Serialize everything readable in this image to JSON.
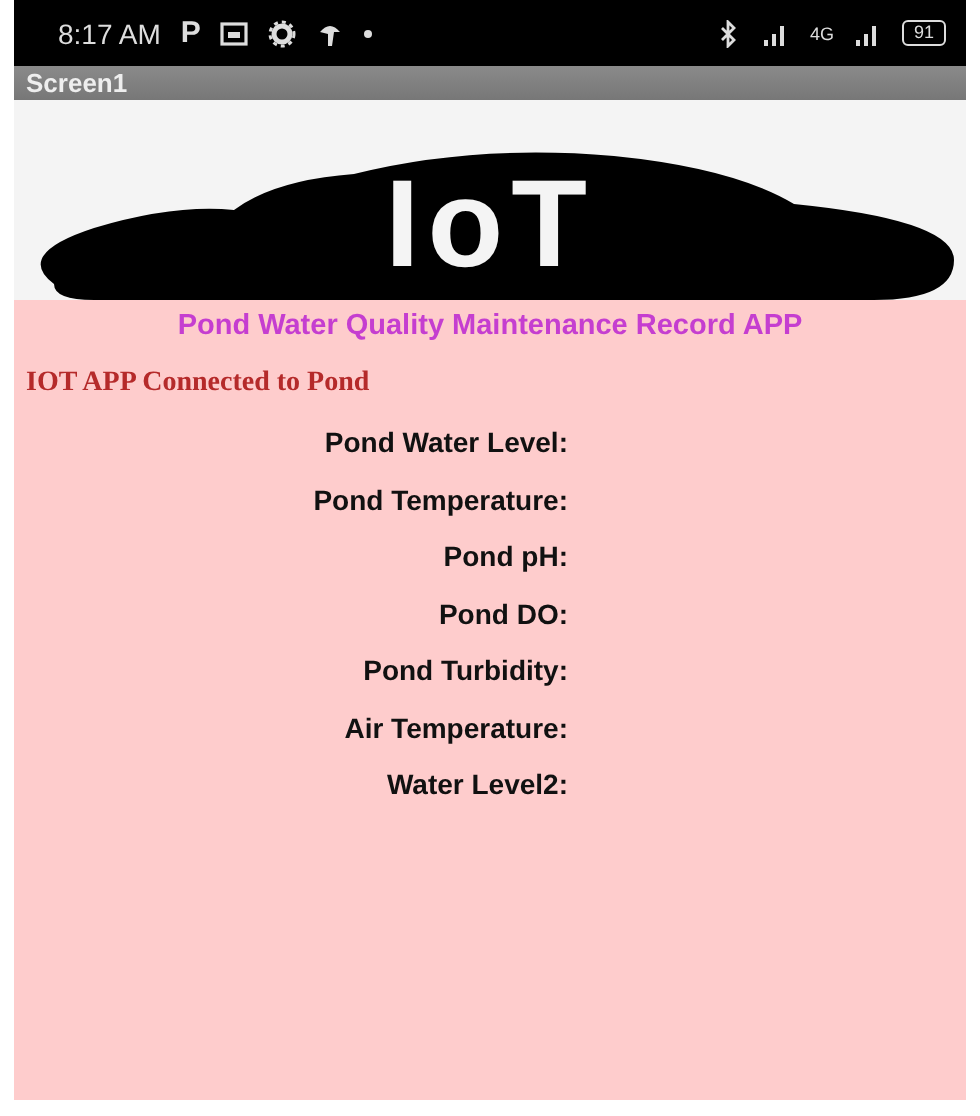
{
  "status_bar": {
    "time": "8:17 AM",
    "app_letter": "P",
    "network": "4G",
    "battery": "91"
  },
  "title_bar": {
    "title": "Screen1"
  },
  "logo": {
    "text": "IoT"
  },
  "heading": "Pond Water Quality Maintenance Record APP",
  "connection_status": "IOT APP Connected to Pond",
  "readings": [
    {
      "label": "Pond Water Level:"
    },
    {
      "label": "Pond Temperature:"
    },
    {
      "label": "Pond pH:"
    },
    {
      "label": "Pond DO:"
    },
    {
      "label": "Pond Turbidity:"
    },
    {
      "label": "Air Temperature:"
    },
    {
      "label": "Water Level2:"
    }
  ]
}
